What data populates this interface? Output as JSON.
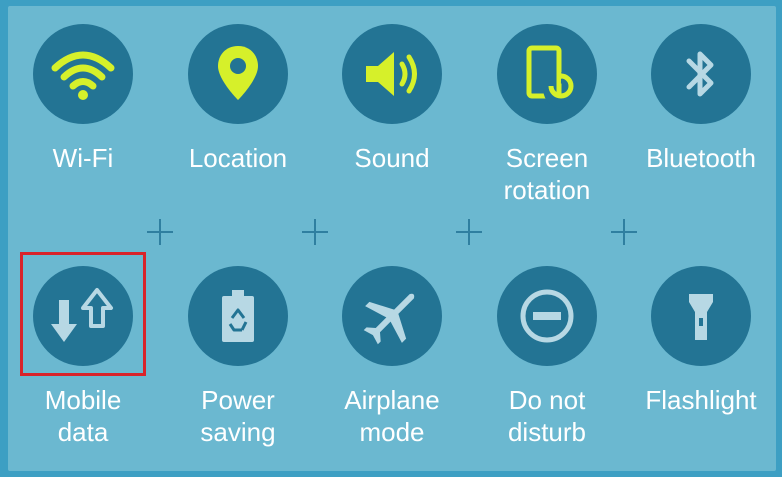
{
  "colors": {
    "background": "#3d9fc3",
    "panel": "#6bb8d0",
    "tile_circle": "#237494",
    "active_icon": "#d6f02a",
    "inactive_icon": "#b7d8e4",
    "highlight": "#d9232a"
  },
  "tiles": [
    {
      "label_lines": [
        "Wi-Fi"
      ],
      "icon": "wifi-icon",
      "active": true
    },
    {
      "label_lines": [
        "Location"
      ],
      "icon": "location-pin-icon",
      "active": true
    },
    {
      "label_lines": [
        "Sound"
      ],
      "icon": "speaker-icon",
      "active": true
    },
    {
      "label_lines": [
        "Screen",
        "rotation"
      ],
      "icon": "screen-rotation-icon",
      "active": true
    },
    {
      "label_lines": [
        "Bluetooth"
      ],
      "icon": "bluetooth-icon",
      "active": false
    },
    {
      "label_lines": [
        "Mobile",
        "data"
      ],
      "icon": "mobile-data-arrows-icon",
      "active": false,
      "highlighted": true
    },
    {
      "label_lines": [
        "Power",
        "saving"
      ],
      "icon": "power-saving-battery-icon",
      "active": false
    },
    {
      "label_lines": [
        "Airplane",
        "mode"
      ],
      "icon": "airplane-icon",
      "active": false
    },
    {
      "label_lines": [
        "Do not",
        "disturb"
      ],
      "icon": "do-not-disturb-icon",
      "active": false
    },
    {
      "label_lines": [
        "Flashlight"
      ],
      "icon": "flashlight-icon",
      "active": false
    }
  ]
}
